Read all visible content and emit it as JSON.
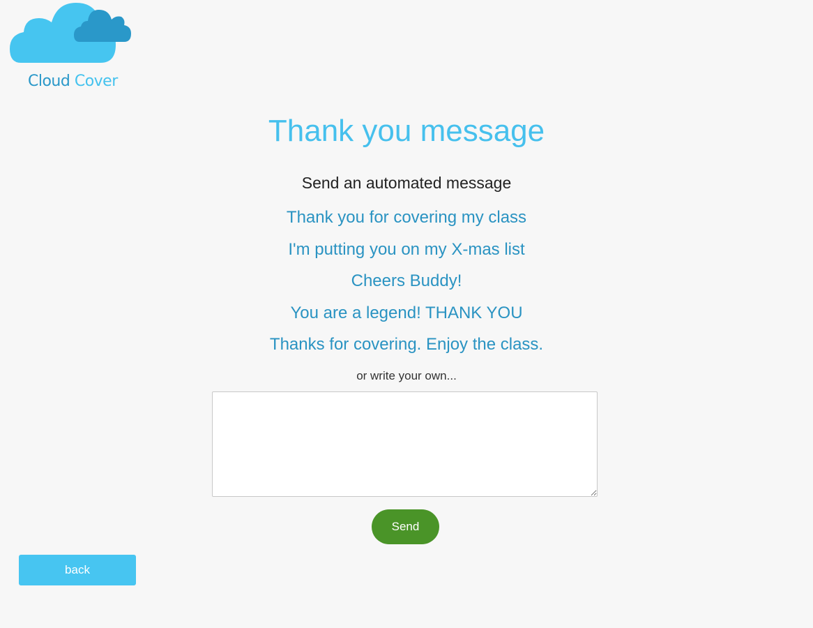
{
  "brand": {
    "word1": "Cloud",
    "word2": "Cover",
    "logo_icon": "cloud-icon",
    "colors": {
      "light_blue": "#46c5f0",
      "dark_blue": "#2a98c9"
    }
  },
  "page": {
    "title": "Thank you message",
    "subtitle": "Send an automated message",
    "messages": [
      "Thank you for covering my class",
      "I'm putting you on my X-mas list",
      "Cheers Buddy!",
      "You are a legend! THANK YOU",
      "Thanks for covering. Enjoy the class."
    ],
    "or_text": "or write your own...",
    "textarea_value": "",
    "send_label": "Send",
    "back_label": "back"
  },
  "colors": {
    "background": "#f7f7f7",
    "accent": "#46c0ed",
    "message_link": "#2a93c2",
    "send_button": "#4a9428",
    "back_button": "#47c5f1"
  }
}
